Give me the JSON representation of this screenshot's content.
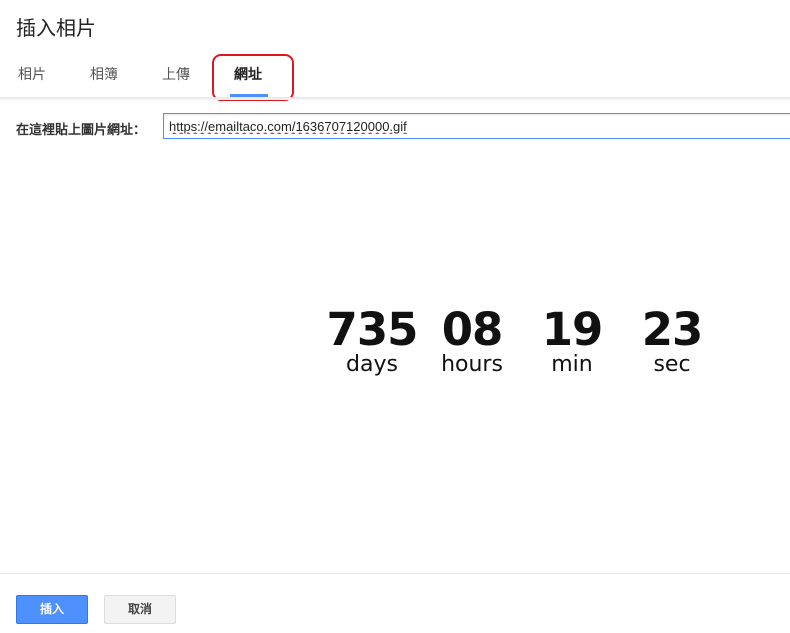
{
  "dialog": {
    "title": "插入相片"
  },
  "tabs": [
    {
      "label": "相片"
    },
    {
      "label": "相簿"
    },
    {
      "label": "上傳"
    },
    {
      "label": "網址"
    }
  ],
  "active_tab": "網址",
  "url_panel": {
    "label": "在這裡貼上圖片網址：",
    "value": "https://emailtaco.com/1636707120000.gif"
  },
  "preview_countdown": [
    {
      "value": "735",
      "label": "days"
    },
    {
      "value": "08",
      "label": "hours"
    },
    {
      "value": "19",
      "label": "min"
    },
    {
      "value": "23",
      "label": "sec"
    }
  ],
  "footer": {
    "insert_label": "插入",
    "cancel_label": "取消"
  },
  "colors": {
    "primary_button": "#4d90fe",
    "tab_underline": "#4d90fe",
    "highlight_box": "#e0161d"
  }
}
